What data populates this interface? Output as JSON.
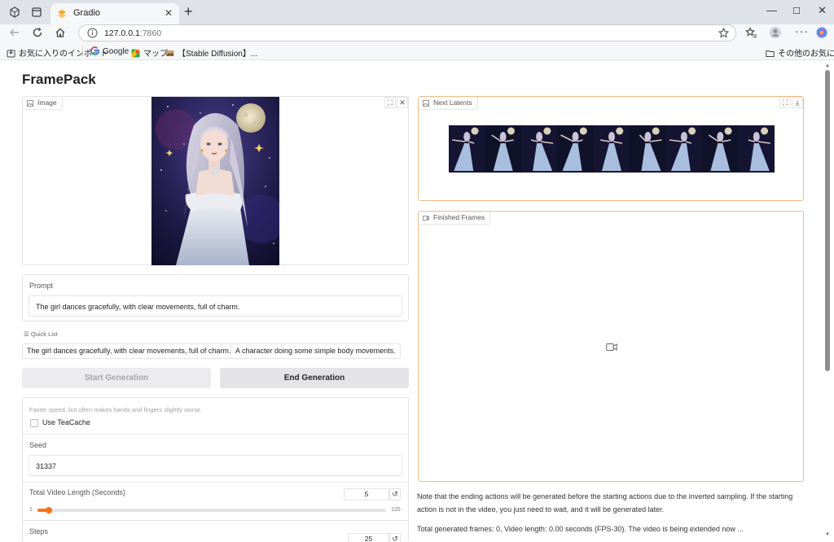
{
  "browser": {
    "tab_title": "Gradio",
    "address_host": "127.0.0.1",
    "address_port": ":7860",
    "bookmarks": [
      "お気に入りのインポート",
      "Google",
      "マップ",
      "【Stable Diffusion】...",
      "その他のお気に入り"
    ]
  },
  "app": {
    "title": "FramePack",
    "image_label": "Image",
    "prompt_label": "Prompt",
    "prompt_value": "The girl dances gracefully, with clear movements, full of charm.",
    "quick_list_label": "Quick List",
    "quick_list": [
      "The girl dances gracefully, with clear movements, full of charm.",
      "A character doing some simple body movements."
    ],
    "start_label": "Start Generation",
    "end_label": "End Generation",
    "teacache_info": "Faster speed, but often makes hands and fingers slightly worse.",
    "teacache_label": "Use TeaCache",
    "teacache_checked": false,
    "seed_label": "Seed",
    "seed_value": "31337",
    "length_label": "Total Video Length (Seconds)",
    "length_value": "5",
    "length_min": "1",
    "length_max": "120",
    "steps_label": "Steps",
    "steps_value": "25",
    "latents_label": "Next Latents",
    "frames_label": "Finished Frames",
    "note_text": "Note that the ending actions will be generated before the starting actions due to the inverted sampling. If the starting action is not in the video, you just need to wait, and it will be generated later.",
    "status_text": "Total generated frames: 0, Video length: 0.00 seconds (FPS-30). The video is being extended now ..."
  },
  "colors": {
    "accent": "#f97316",
    "orange_border": "#f0b98a",
    "end_button_bg": "#e4e4e7",
    "start_button_bg": "#ececee"
  }
}
